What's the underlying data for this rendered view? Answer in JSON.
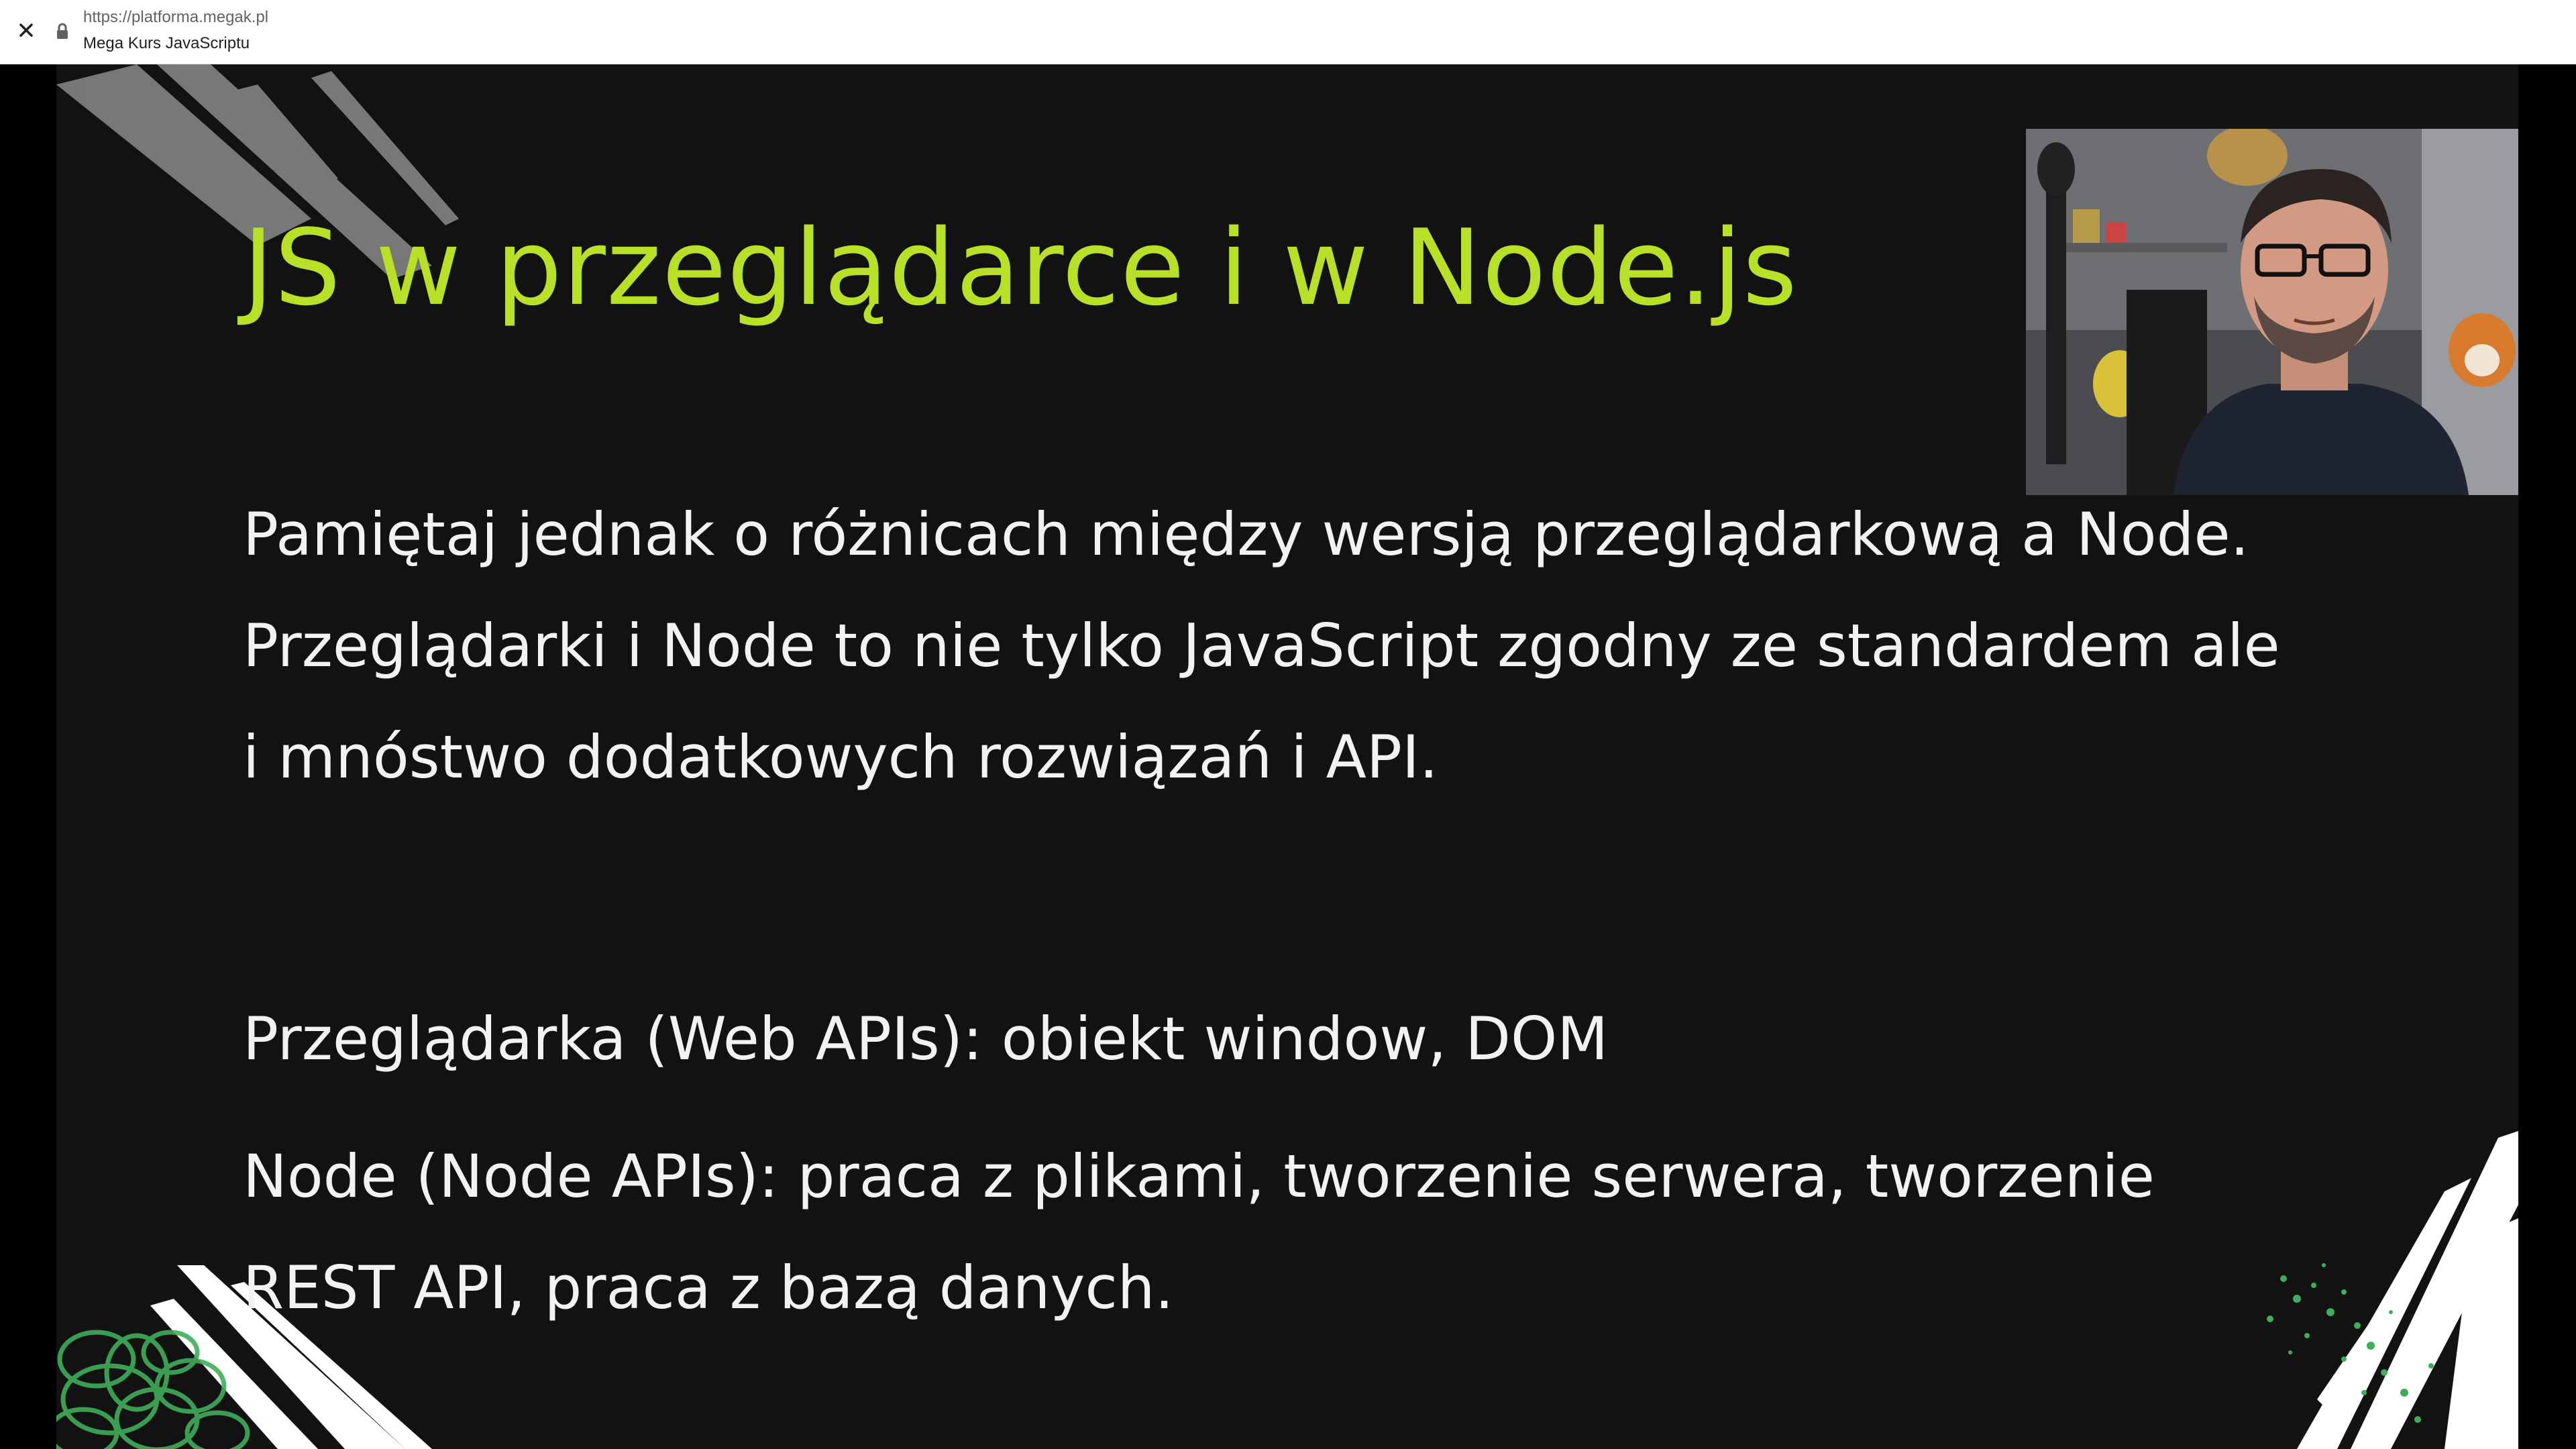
{
  "browser": {
    "url": "https://platforma.megak.pl",
    "title": "Mega Kurs JavaScriptu"
  },
  "slide": {
    "title": "JS w przeglądarce i w Node.js",
    "paragraph1": "Pamiętaj jednak o różnicach między wersją przeglądarkową a Node. Przeglądarki i Node to nie tylko JavaScript zgodny ze standardem ale i mnóstwo dodatkowych rozwiązań i API.",
    "paragraph2": "Przeglądarka (Web APIs): obiekt window, DOM",
    "paragraph3": "Node (Node APIs): praca z plikami, tworzenie serwera, tworzenie REST API, praca z bazą danych."
  },
  "colors": {
    "title_accent": "#b7e026",
    "slide_background": "#121212",
    "text": "#f2f2f2",
    "decoration_green": "#3fae5a"
  },
  "icons": {
    "close": "close-icon",
    "lock": "lock-icon"
  }
}
